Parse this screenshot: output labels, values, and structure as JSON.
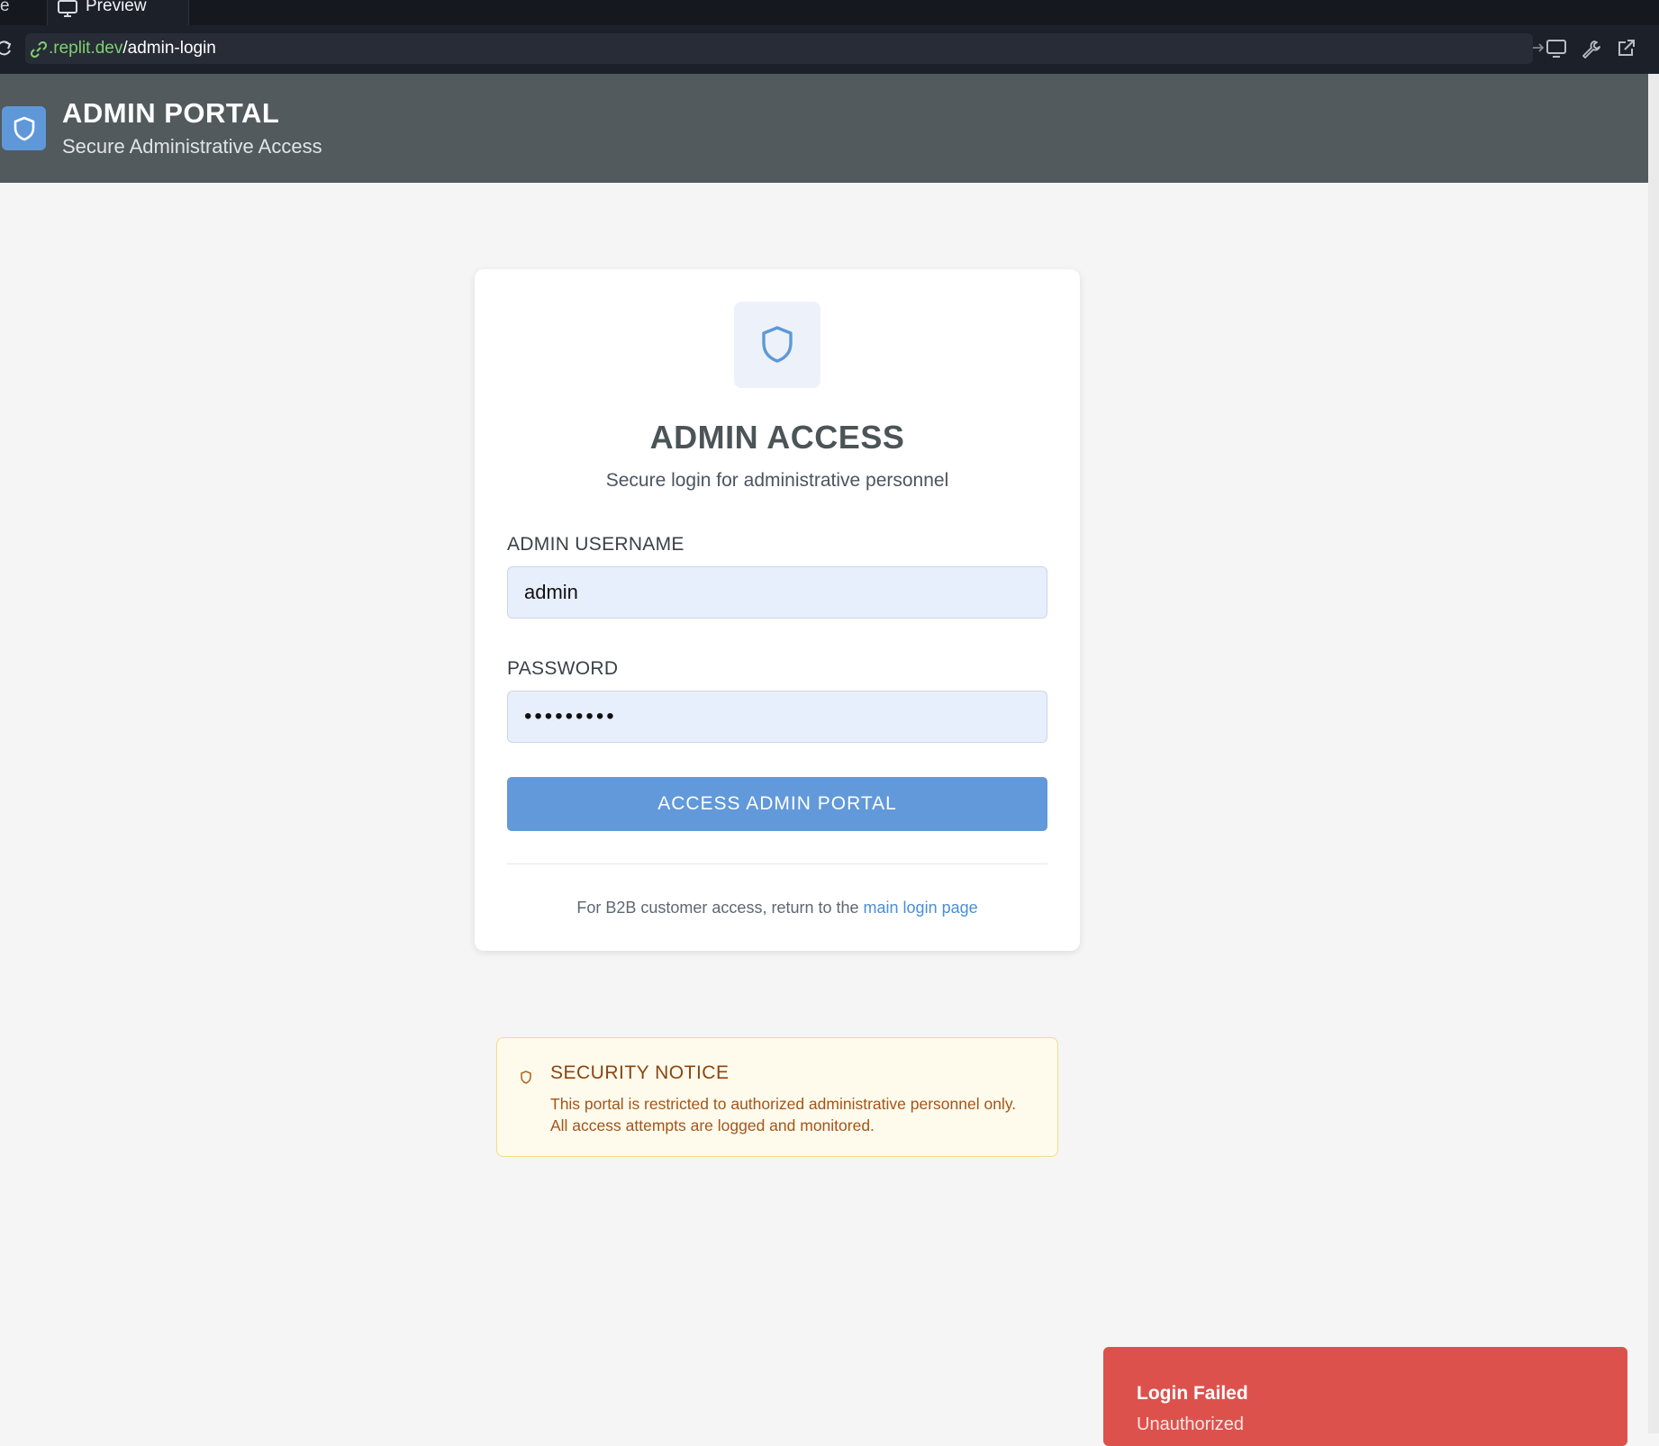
{
  "browser": {
    "tab_edge": "e",
    "preview_tab": "Preview",
    "url_domain": ".replit.dev",
    "url_path": "/admin-login"
  },
  "header": {
    "title": "ADMIN PORTAL",
    "subtitle": "Secure Administrative Access"
  },
  "card": {
    "title": "ADMIN ACCESS",
    "subtitle": "Secure login for administrative personnel",
    "username_label": "ADMIN USERNAME",
    "username_value": "admin",
    "password_label": "PASSWORD",
    "password_value": "•••••••••",
    "submit_label": "ACCESS ADMIN PORTAL",
    "footer_prefix": "For B2B customer access, return to the",
    "footer_link": "main login page"
  },
  "notice": {
    "title": "SECURITY NOTICE",
    "body": "This portal is restricted to authorized administrative personnel only. All access attempts are logged and monitored."
  },
  "toast": {
    "title": "Login Failed",
    "message": "Unauthorized"
  },
  "colors": {
    "header_bg": "#525a5d",
    "accent": "#6199da",
    "toast_bg": "#dd514c",
    "notice_bg": "#fefbec"
  },
  "icons": [
    "reload-icon",
    "link-icon",
    "monitor-icon",
    "arrow-right-icon",
    "wrench-icon",
    "external-link-icon",
    "shield-icon"
  ]
}
